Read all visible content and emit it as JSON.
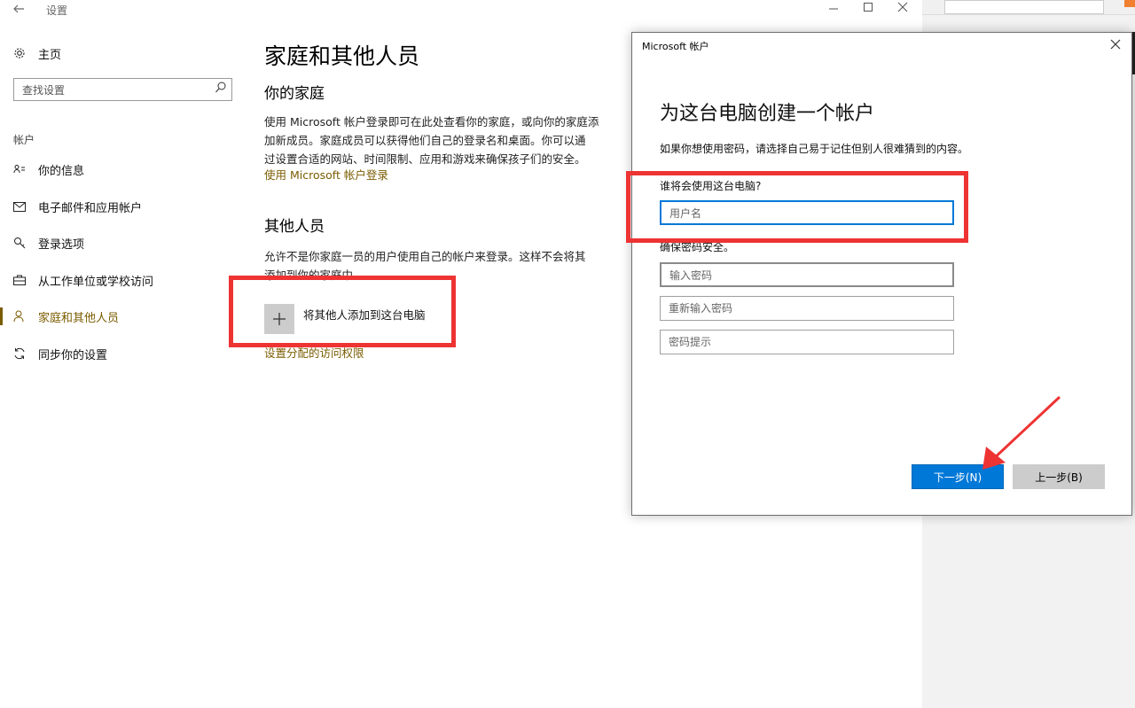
{
  "window": {
    "title": "设置",
    "back_icon": "arrow-left-icon",
    "controls": [
      "minimize",
      "maximize",
      "close"
    ]
  },
  "sidebar": {
    "home_label": "主页",
    "search_placeholder": "查找设置",
    "section_title": "帐户",
    "items": [
      {
        "label": "你的信息",
        "icon": "person-list-icon"
      },
      {
        "label": "电子邮件和应用帐户",
        "icon": "mail-icon"
      },
      {
        "label": "登录选项",
        "icon": "key-icon"
      },
      {
        "label": "从工作单位或学校访问",
        "icon": "briefcase-icon"
      },
      {
        "label": "家庭和其他人员",
        "icon": "person-icon",
        "active": true
      },
      {
        "label": "同步你的设置",
        "icon": "sync-icon"
      }
    ]
  },
  "main": {
    "title": "家庭和其他人员",
    "family": {
      "heading": "你的家庭",
      "description_lines": [
        "使用 Microsoft 帐户登录即可在此处查看你的家庭，或向你的家庭添",
        "加新成员。家庭成员可以获得他们自己的登录名和桌面。你可以通",
        "过设置合适的网站、时间限制、应用和游戏来确保孩子们的安全。"
      ],
      "link": "使用 Microsoft 帐户登录"
    },
    "others": {
      "heading": "其他人员",
      "description_lines": [
        "允许不是你家庭一员的用户使用自己的帐户来登录。这样不会将其",
        "添加到你的家庭中。"
      ],
      "add_label": "将其他人添加到这台电脑",
      "assigned_access_link": "设置分配的访问权限"
    }
  },
  "dialog": {
    "title": "Microsoft 帐户",
    "heading": "为这台电脑创建一个帐户",
    "description": "如果你想使用密码，请选择自己易于记住但别人很难猜到的内容。",
    "who_label": "谁将会使用这台电脑?",
    "username_placeholder": "用户名",
    "password_section_label": "确保密码安全。",
    "password_placeholder": "输入密码",
    "reenter_placeholder": "重新输入密码",
    "hint_placeholder": "密码提示",
    "next_button": "下一步(N)",
    "back_button": "上一步(B)"
  },
  "colors": {
    "accent_link": "#7a5c00",
    "primary_button": "#0078d7",
    "annotation_red": "#ee3333"
  }
}
